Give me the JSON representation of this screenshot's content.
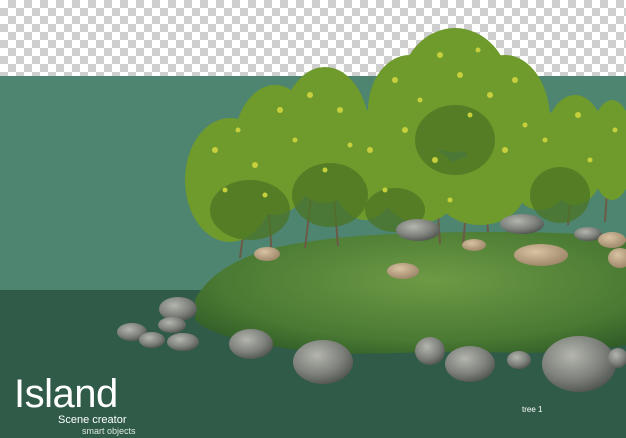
{
  "caption": {
    "title": "Island",
    "subtitle": "Scene creator",
    "tagline": "smart objects"
  },
  "object_label": "tree 1",
  "colors": {
    "backdrop_upper": "#4e8570",
    "backdrop_lower": "#2f5b48",
    "foliage": "#6f9a2c",
    "flowers": "#c6cf3c",
    "grass": "#4f7d34",
    "rock": "#8a8d88"
  }
}
